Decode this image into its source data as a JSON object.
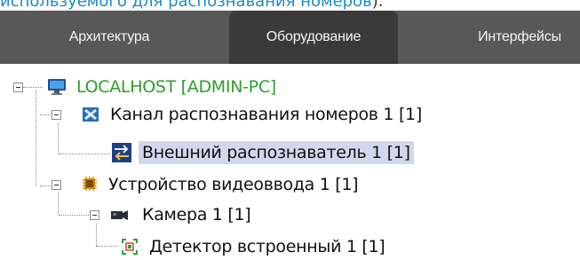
{
  "caption": {
    "text": "используемого для распознавания номеров",
    "tail": ")."
  },
  "tabs": [
    {
      "label": "Архитектура"
    },
    {
      "label": "Оборудование",
      "active": true
    },
    {
      "label": "Интерфейсы"
    }
  ],
  "tree": {
    "root": {
      "label": "LOCALHOST [ADMIN-PC]",
      "icon": "computer-icon"
    },
    "lpr_channel": {
      "label": "Канал распознавания номеров 1 [1]",
      "icon": "license-plate-channel-icon"
    },
    "external_recognizer": {
      "label": "Внешний распознаватель 1 [1]",
      "icon": "external-recognizer-icon",
      "selected": true
    },
    "video_input": {
      "label": "Устройство видеоввода 1 [1]",
      "icon": "video-capture-chip-icon"
    },
    "camera": {
      "label": "Камера 1 [1]",
      "icon": "camera-icon"
    },
    "detector": {
      "label": "Детектор встроенный 1 [1]",
      "icon": "detector-icon"
    }
  },
  "colors": {
    "tabbar": "#585858",
    "active_tab": "#3a3a3a",
    "root_text": "#2aa02a",
    "selection": "#d2d8ec",
    "caption_link": "#1a8bc6"
  }
}
